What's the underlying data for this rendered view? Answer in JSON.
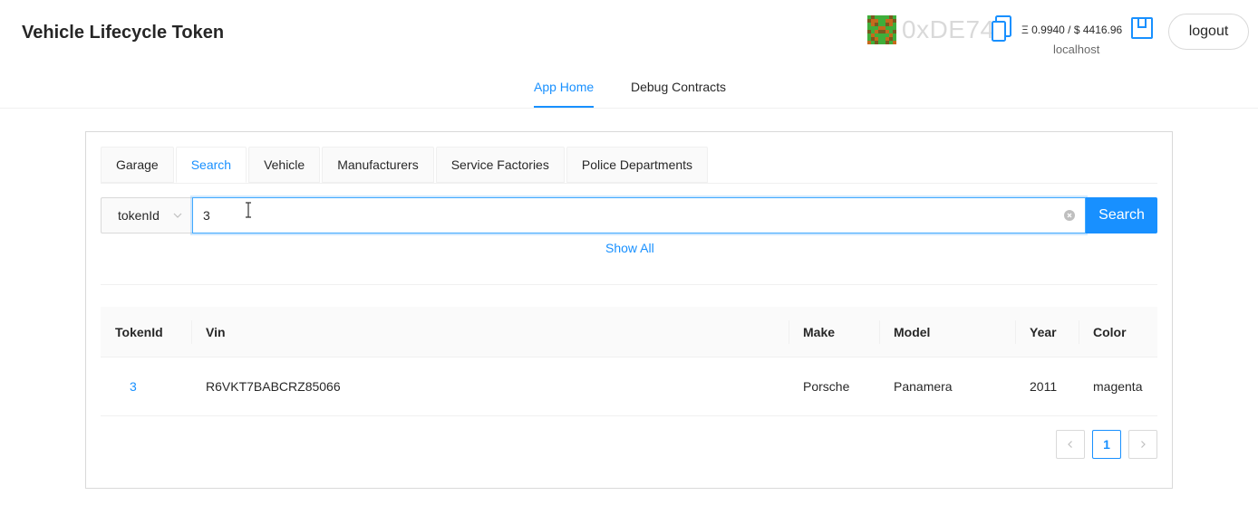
{
  "header": {
    "app_title": "Vehicle Lifecycle Token",
    "address": "0xDE74",
    "balance": "Ξ 0.9940 / $ 4416.96",
    "network": "localhost",
    "logout_label": "logout",
    "icons": [
      "blockie-avatar-icon",
      "copy-icon",
      "wallet-icon"
    ]
  },
  "top_nav": {
    "items": [
      {
        "label": "App Home",
        "active": true
      },
      {
        "label": "Debug Contracts",
        "active": false
      }
    ]
  },
  "tabs": [
    {
      "label": "Garage",
      "active": false
    },
    {
      "label": "Search",
      "active": true
    },
    {
      "label": "Vehicle",
      "active": false
    },
    {
      "label": "Manufacturers",
      "active": false
    },
    {
      "label": "Service Factories",
      "active": false
    },
    {
      "label": "Police Departments",
      "active": false
    }
  ],
  "search": {
    "field_selected": "tokenId",
    "value": "3",
    "button_label": "Search",
    "show_all_label": "Show All"
  },
  "table": {
    "columns": [
      "TokenId",
      "Vin",
      "Make",
      "Model",
      "Year",
      "Color"
    ],
    "rows": [
      {
        "tokenId": "3",
        "vin": "R6VKT7BABCRZ85066",
        "make": "Porsche",
        "model": "Panamera",
        "year": "2011",
        "color": "magenta"
      }
    ]
  },
  "pagination": {
    "current_page": "1",
    "prev_icon": "chevron-left-icon",
    "next_icon": "chevron-right-icon"
  },
  "colors": {
    "accent": "#1890ff",
    "border": "#d9d9d9",
    "header_bg": "#fafafa"
  }
}
